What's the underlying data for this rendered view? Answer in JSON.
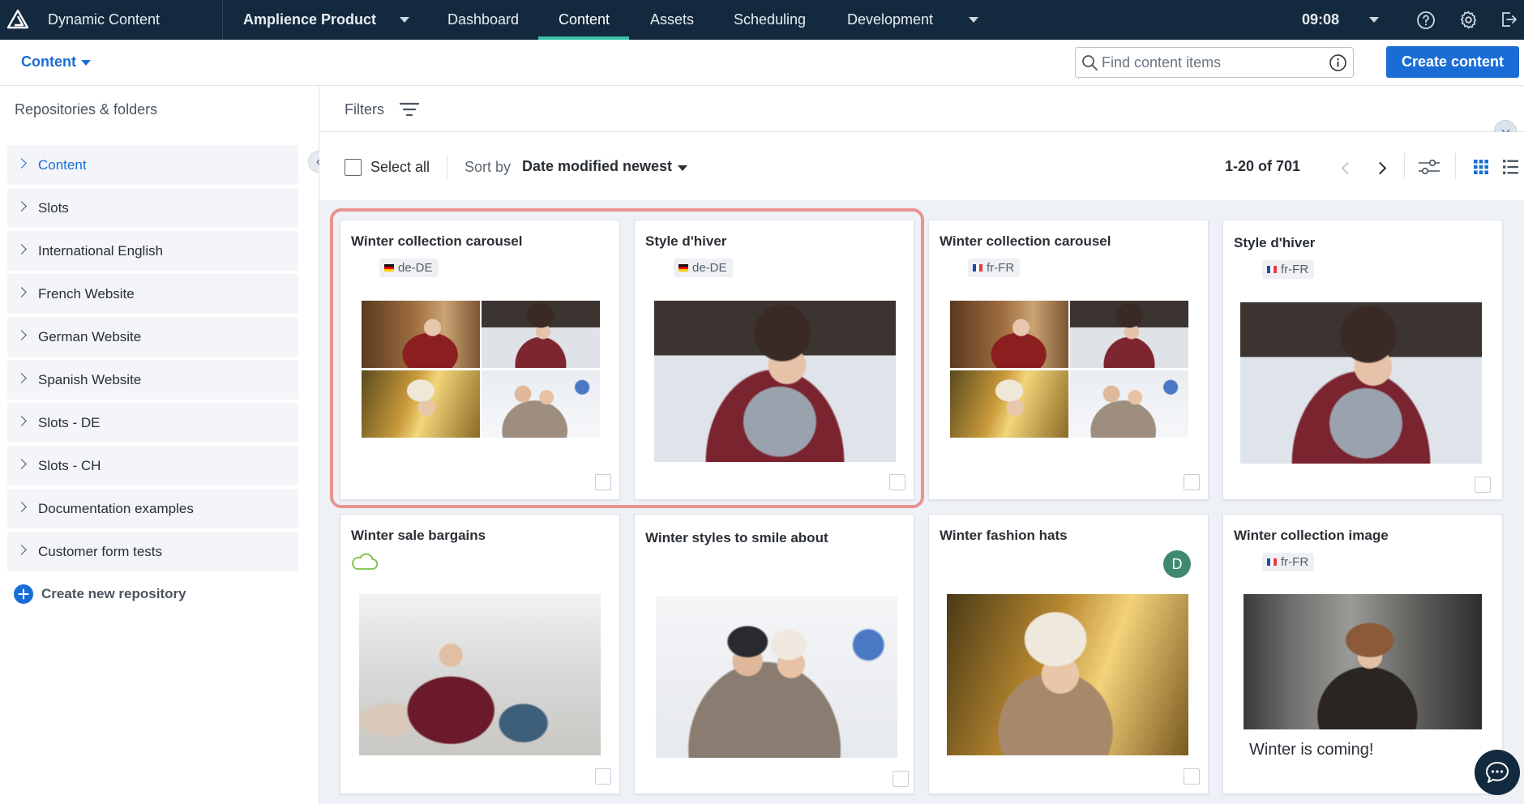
{
  "topbar": {
    "app_name": "Dynamic Content",
    "hub_name": "Amplience Product",
    "nav": [
      "Dashboard",
      "Content",
      "Assets",
      "Scheduling",
      "Development"
    ],
    "active_nav": "Content",
    "time": "09:08"
  },
  "subbar": {
    "section_label": "Content",
    "search_placeholder": "Find content items",
    "create_button": "Create content"
  },
  "sidebar": {
    "heading": "Repositories & folders",
    "items": [
      {
        "label": "Content",
        "active": true
      },
      {
        "label": "Slots"
      },
      {
        "label": "International English"
      },
      {
        "label": "French Website"
      },
      {
        "label": "German Website"
      },
      {
        "label": "Spanish Website"
      },
      {
        "label": "Slots - DE"
      },
      {
        "label": "Slots - CH"
      },
      {
        "label": "Documentation examples"
      },
      {
        "label": "Customer form tests"
      }
    ],
    "create_repo": "Create new repository"
  },
  "filters": {
    "label": "Filters"
  },
  "toolbar": {
    "select_all": "Select all",
    "sort_by": "Sort by",
    "sort_value": "Date modified newest",
    "pagination": "1-20 of 701"
  },
  "cards": [
    {
      "title": "Winter collection carousel",
      "locale": "de-DE",
      "flag": "de"
    },
    {
      "title": "Style d'hiver",
      "locale": "de-DE",
      "flag": "de"
    },
    {
      "title": "Winter collection carousel",
      "locale": "fr-FR",
      "flag": "fr"
    },
    {
      "title": "Style d'hiver",
      "locale": "fr-FR",
      "flag": "fr"
    },
    {
      "title": "Winter sale bargains"
    },
    {
      "title": "Winter styles to smile about"
    },
    {
      "title": "Winter fashion hats",
      "avatar": "D"
    },
    {
      "title": "Winter collection image",
      "locale": "fr-FR",
      "flag": "fr",
      "caption": "Winter is coming!"
    }
  ],
  "colors": {
    "topbar": "#132a3e",
    "accent": "#1b6dd6",
    "active_underline": "#38c0a8",
    "highlight": "#e8837f",
    "avatar": "#3f8a6f"
  }
}
